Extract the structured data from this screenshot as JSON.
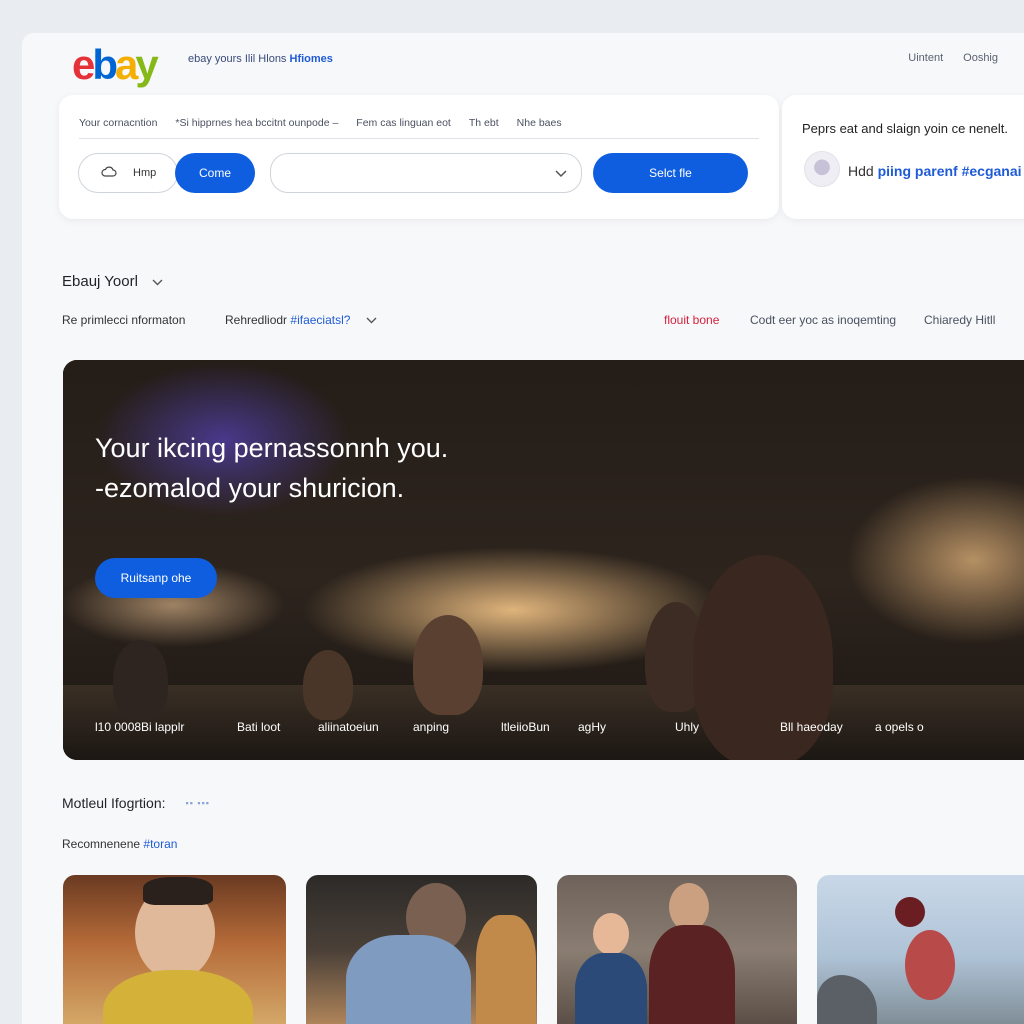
{
  "header": {
    "logo_letters": [
      "e",
      "b",
      "a",
      "y"
    ],
    "logo_colors": [
      "#e53238",
      "#0064d2",
      "#f5af02",
      "#86b817"
    ],
    "tagline": "ebay yours Ilil Hlons",
    "tagline_accent": "Hfiomes",
    "links": [
      "Uintent",
      "Ooshig"
    ]
  },
  "search": {
    "breadcrumbs": [
      "Your cornacntion",
      "*Si hipprnes hea bccitnt ounpode –",
      "Fem cas linguan eot",
      "Th ebt",
      "Nhe baes"
    ],
    "home_label": "Hmp",
    "home_icon": "cloud-icon",
    "come_label": "Come",
    "select_value": "",
    "select_button_label": "Selct fle"
  },
  "promo": {
    "title": "Peprs eat and slaign yoin ce nenelt.",
    "line_text": "Hdd",
    "line_bold": "piing parenf",
    "line_accent": "#ecganai"
  },
  "section": {
    "title": "Ebauj Yoorl",
    "filters": {
      "f1": "Re primlecci nformaton",
      "f2_text": "Rehredliodr",
      "f2_accent": "#ifaeciatsl?",
      "f3": "flouit bone",
      "f4": "Codt eer yoc as inoqemting",
      "f5": "Chiaredy Hitll"
    }
  },
  "hero": {
    "headline_1": "Your ikcing pernassonnh you.",
    "headline_2": "-ezomalod your shuricion.",
    "button_label": "Ruitsanp ohe",
    "captions": [
      "l10 0008Bi lapplr",
      "Bati loot",
      "aliinatoeiun",
      "anping",
      "ltleiioBun",
      "agHy",
      "Uhly",
      "Bll haeoday",
      "a opels o"
    ]
  },
  "bottom": {
    "title": "Motleul Ifogrtion:",
    "dots": "▪▪ ▪▪▪",
    "rec_text": "Recomnenene",
    "rec_accent": "#toran"
  },
  "colors": {
    "accent_blue": "#0f5ee0",
    "link_blue": "#1f5bd6",
    "red": "#d6213d"
  }
}
